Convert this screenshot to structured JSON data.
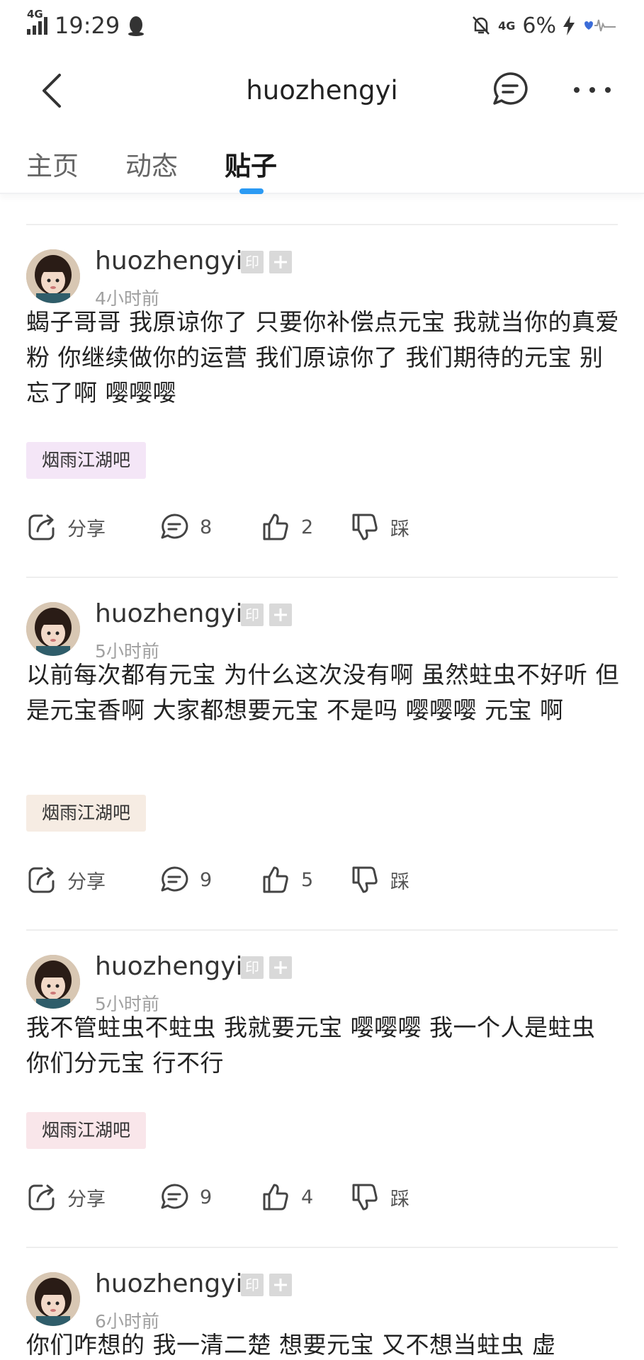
{
  "status_bar": {
    "time": "19:29",
    "network_left": "4G",
    "network_right": "4G",
    "battery": "6%"
  },
  "nav": {
    "title": "huozhengyi"
  },
  "tabs": [
    {
      "label": "主页",
      "active": false
    },
    {
      "label": "动态",
      "active": false
    },
    {
      "label": "贴子",
      "active": true
    }
  ],
  "posts": [
    {
      "author": "huozhengyi",
      "badge_label": "印",
      "time": "4小时前",
      "content": "蝎子哥哥 我原谅你了 只要你补偿点元宝 我就当你的真爱粉 你继续做你的运营 我们原谅你了 我们期待的元宝 别忘了啊 嘤嘤嘤",
      "forum": "烟雨江湖吧",
      "forum_bg": "#f4e6f7",
      "share": "分享",
      "comments": "8",
      "likes": "2",
      "dislike": "踩"
    },
    {
      "author": "huozhengyi",
      "badge_label": "印",
      "time": "5小时前",
      "content": "以前每次都有元宝 为什么这次没有啊 虽然蛀虫不好听 但是元宝香啊 大家都想要元宝 不是吗 嘤嘤嘤 元宝 啊",
      "forum": "烟雨江湖吧",
      "forum_bg": "#f6ece3",
      "share": "分享",
      "comments": "9",
      "likes": "5",
      "dislike": "踩"
    },
    {
      "author": "huozhengyi",
      "badge_label": "印",
      "time": "5小时前",
      "content": "我不管蛀虫不蛀虫 我就要元宝 嘤嘤嘤 我一个人是蛀虫 你们分元宝 行不行",
      "forum": "烟雨江湖吧",
      "forum_bg": "#f9e6ea",
      "share": "分享",
      "comments": "9",
      "likes": "4",
      "dislike": "踩"
    },
    {
      "author": "huozhengyi",
      "badge_label": "印",
      "time": "6小时前",
      "content": "你们咋想的 我一清二楚 想要元宝 又不想当蛀虫 虚"
    }
  ]
}
